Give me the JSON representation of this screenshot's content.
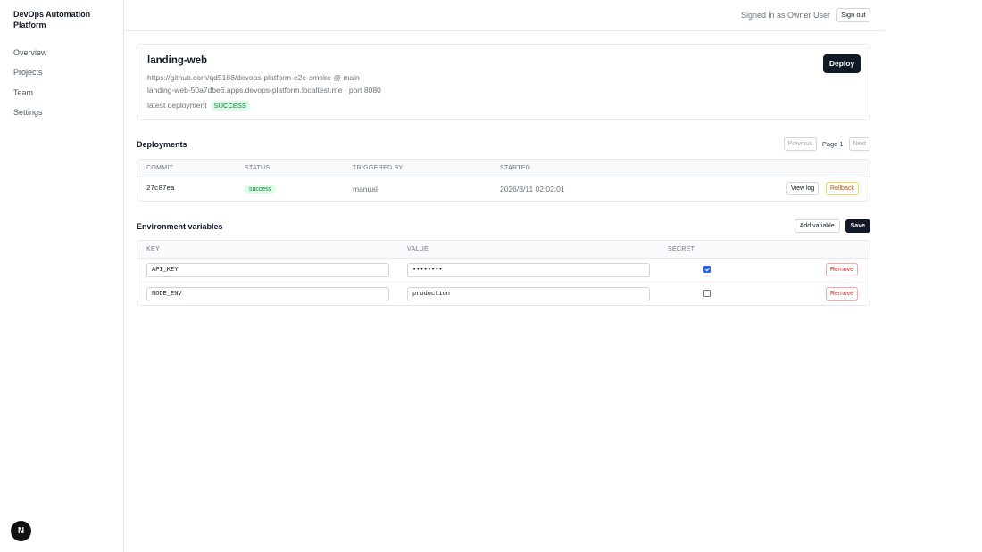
{
  "sidebar": {
    "brand": "DevOps Automation Platform",
    "items": [
      {
        "label": "Overview"
      },
      {
        "label": "Projects"
      },
      {
        "label": "Team"
      },
      {
        "label": "Settings"
      }
    ],
    "badge": "N"
  },
  "header": {
    "signed_in": "Signed in as Owner User",
    "sign_out": "Sign out"
  },
  "project": {
    "name": "landing-web",
    "repo": "https://github.com/qd5168/devops-platform-e2e-smoke @ main",
    "host": "landing-web-50a7dbe6.apps.devops-platform.localtest.me · port 8080",
    "latest_label": "latest deployment",
    "latest_status": "SUCCESS",
    "deploy_label": "Deploy"
  },
  "deployments": {
    "title": "Deployments",
    "pager": {
      "previous": "Previous",
      "page": "Page 1",
      "next": "Next"
    },
    "columns": [
      "COMMIT",
      "STATUS",
      "TRIGGERED BY",
      "STARTED"
    ],
    "rows": [
      {
        "commit": "27c87ea",
        "status": "success",
        "triggered_by": "manual",
        "started": "2026/8/11 02:02:01",
        "view_log": "View log",
        "rollback": "Rollback"
      }
    ]
  },
  "env": {
    "title": "Environment variables",
    "add_label": "Add variable",
    "save_label": "Save",
    "columns": [
      "KEY",
      "VALUE",
      "SECRET"
    ],
    "rows": [
      {
        "key": "API_KEY",
        "value": "••••••••",
        "secret": true,
        "remove": "Remove"
      },
      {
        "key": "NODE_ENV",
        "value": "production",
        "secret": false,
        "remove": "Remove"
      }
    ]
  },
  "colors": {
    "accent": "#111827",
    "success_bg": "#dcfce7",
    "success_text": "#15803d",
    "danger": "#dc2626",
    "warning": "#b45309"
  }
}
